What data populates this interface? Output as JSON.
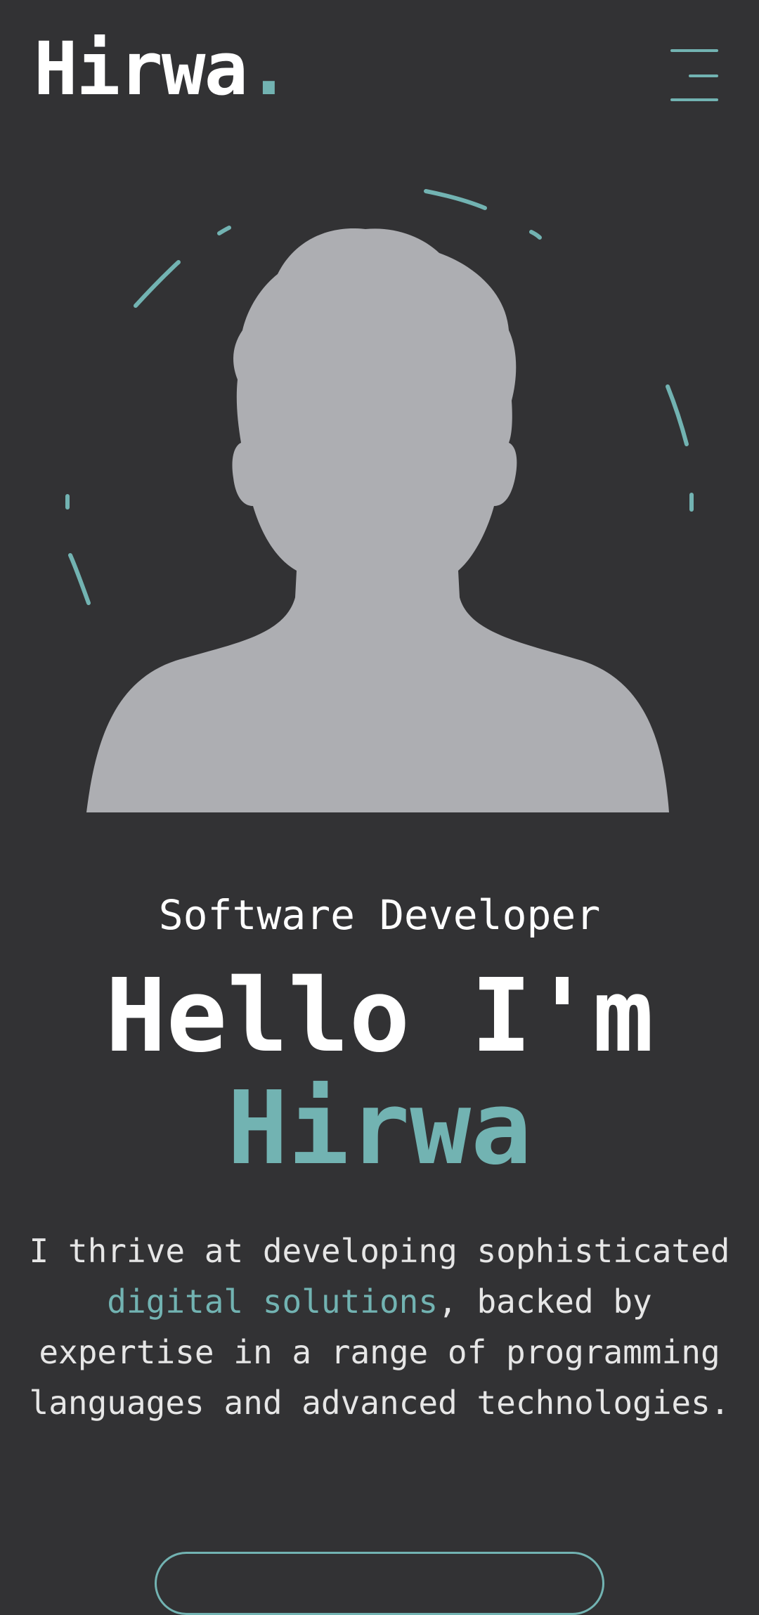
{
  "header": {
    "logo_text": "Hirwa",
    "logo_dot": ".",
    "menu_icon": "hamburger-menu-icon"
  },
  "hero": {
    "image": "person-silhouette-placeholder",
    "decoration": "dashed-circle-ring"
  },
  "intro": {
    "role": "Software Developer",
    "greeting": "Hello I'm",
    "name": "Hirwa",
    "description_part1": "I thrive at developing sophisticated ",
    "description_highlight": "digital solutions",
    "description_part2": ", backed by expertise in a range of programming languages and advanced technologies."
  },
  "colors": {
    "background": "#323234",
    "accent": "#72b3b2",
    "text": "#ffffff",
    "silhouette": "#adaeb2"
  }
}
